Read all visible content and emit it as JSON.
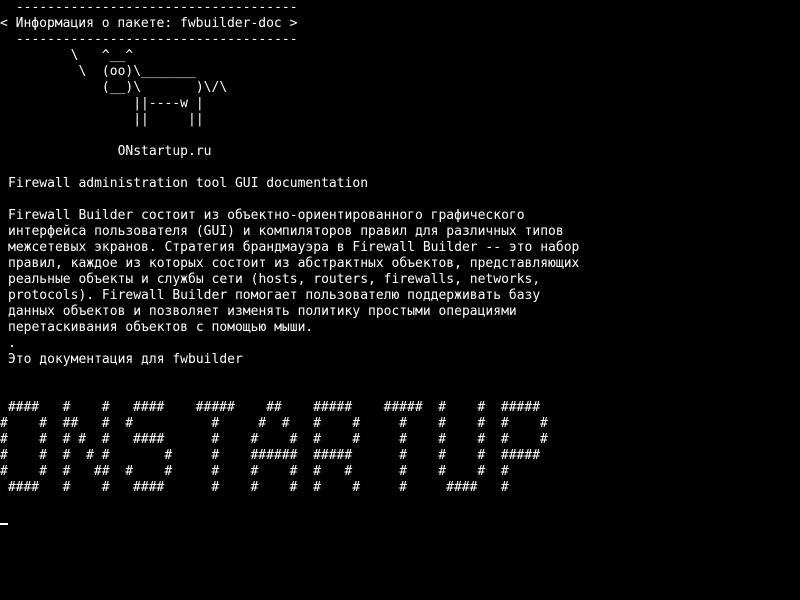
{
  "terminal": {
    "colors": {
      "background": "#000000",
      "foreground": "#ffffff"
    },
    "cowsay": {
      "border_top": " ------------------------------------",
      "message": "< Информация о пакете: fwbuilder-doc >",
      "border_bottom": " ------------------------------------",
      "art": [
        "        \\   ^__^",
        "         \\  (oo)\\_______",
        "            (__)\\       )\\/\\",
        "                ||----w |",
        "                ||     ||"
      ],
      "site": "              ONstartup.ru"
    },
    "package": {
      "summary": "Firewall administration tool GUI documentation",
      "description": [
        "Firewall Builder состоит из объектно-ориентированного графического",
        "интерфейса пользователя (GUI) и компиляторов правил для различных типов",
        "межсетевых экранов. Стратегия брандмауэра в Firewall Builder -- это набор",
        "правил, каждое из которых состоит из абстрактных объектов, представляющих",
        "реальные объекты и службы сети (hosts, routers, firewalls, networks,",
        "protocols). Firewall Builder помогает пользователю поддерживать базу",
        "данных объектов и позволяет изменять политику простыми операциями",
        "перетаскивания объектов с помощью мыши.",
        ".",
        "Это документация для fwbuilder"
      ]
    },
    "banner": [
      " ####   #    #   ####    #####    ##    #####    #####  #    #  #####",
      "#    #  ##   #  #          #     #  #   #    #     #    #    #  #    #",
      "#    #  # #  #   ####      #    #    #  #    #     #    #    #  #    #",
      "#    #  #  # #       #     #    ######  #####      #    #    #  #####",
      "#    #  #   ##  #    #     #    #    #  #   #      #    #    #  #",
      " ####   #    #   ####      #    #    #  #    #     #     ####   #"
    ]
  }
}
